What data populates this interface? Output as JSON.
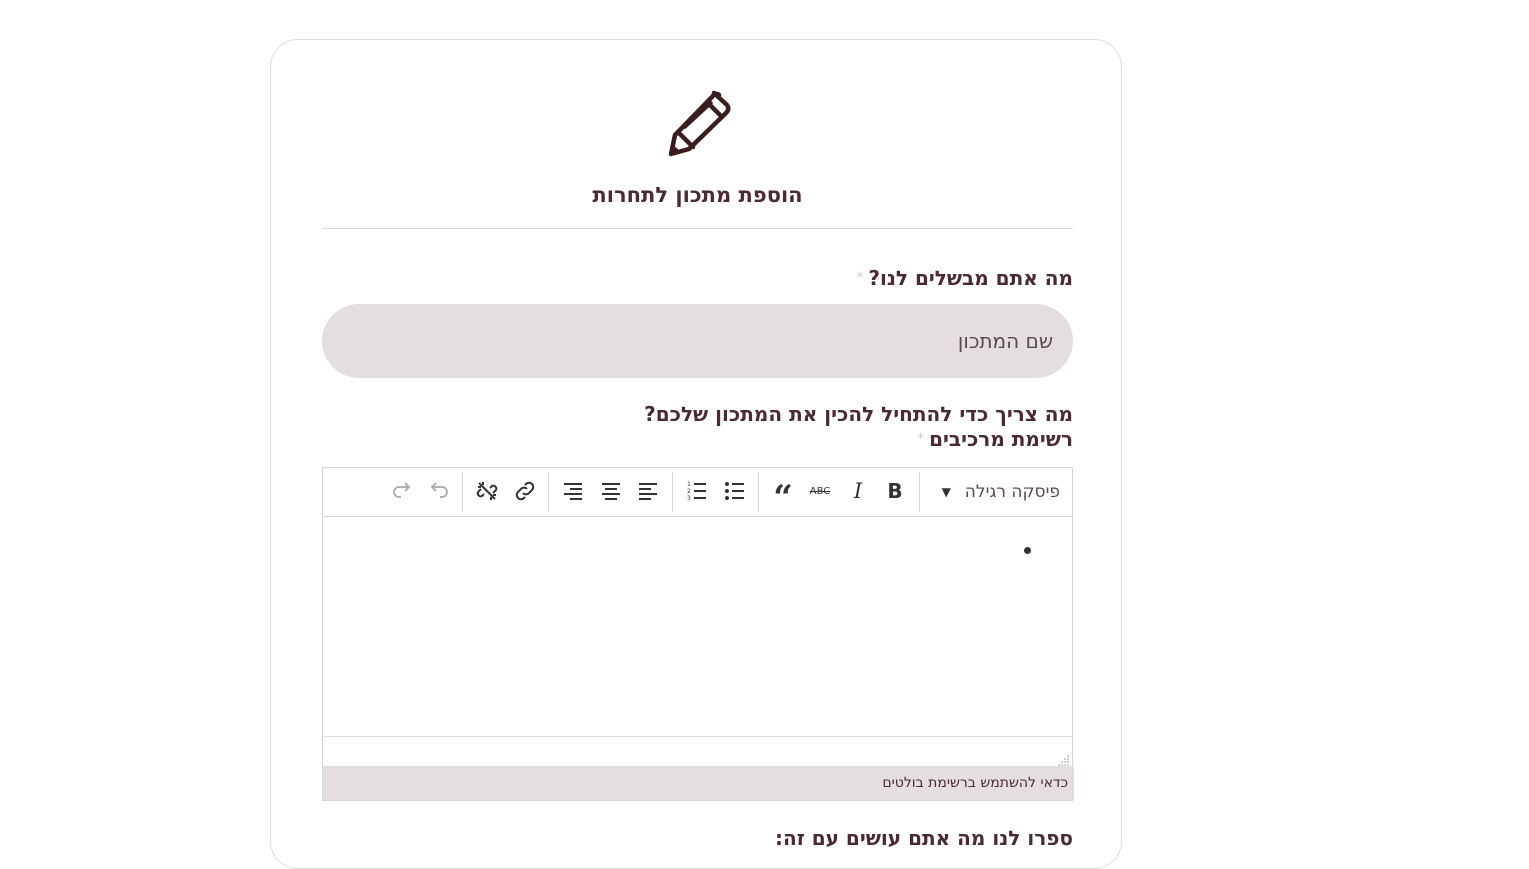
{
  "form": {
    "title": "הוספת מתכון לתחרות",
    "icon": "pencil-icon",
    "colors": {
      "primary": "#4a2a33",
      "input_bg": "#e4dede",
      "border": "#e2dcdc"
    }
  },
  "fields": {
    "recipe_name": {
      "label": "מה אתם מבשלים לנו?",
      "required_mark": "*",
      "placeholder": "שם המתכון"
    },
    "ingredients": {
      "label_line1": "מה צריך כדי להתחיל להכין את המתכון שלכם?",
      "label_line2": "רשימת מרכיבים",
      "required_mark": "*",
      "hint": "כדאי להשתמש ברשימת בולטים"
    },
    "next_label_partial": "ספרו לנו מה אתם עושים עם זה:"
  },
  "editor": {
    "paragraph_format": "פיסקה רגילה",
    "buttons": [
      "bold",
      "italic",
      "strikethrough",
      "blockquote",
      "bulleted-list",
      "numbered-list",
      "align-left",
      "align-center",
      "align-right",
      "link",
      "unlink",
      "undo",
      "redo"
    ],
    "bold_glyph": "B",
    "italic_glyph": "I",
    "strike_glyph": "ABC",
    "quote_glyph": "“"
  }
}
